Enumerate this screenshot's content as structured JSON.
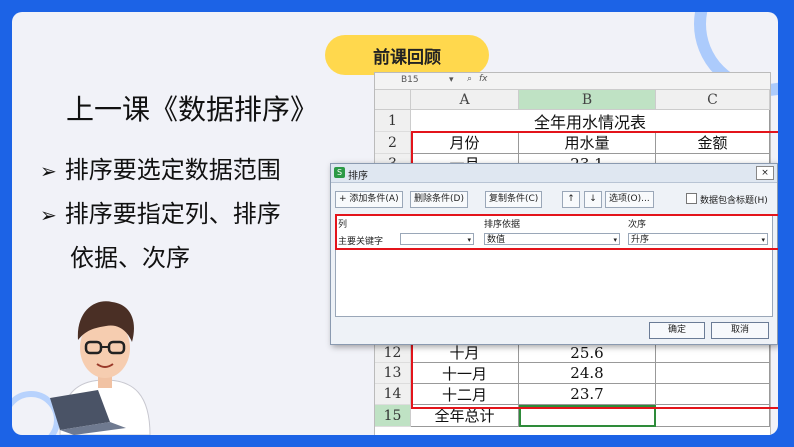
{
  "slide": {
    "badge": "前课回顾",
    "title": "上一课《数据排序》",
    "bullets": [
      {
        "arrow": "➢",
        "text": "排序要选定数据范围"
      },
      {
        "arrow": "➢",
        "text": "排序要指定列、排序"
      }
    ],
    "continuation": "依据、次序"
  },
  "sheet": {
    "name_box": "B15",
    "fx_label": "fx",
    "col_headers": [
      "A",
      "B",
      "C"
    ],
    "title_row": {
      "num": "1",
      "text": "全年用水情况表"
    },
    "header_row": {
      "num": "2",
      "cells": [
        "月份",
        "用水量",
        "金额"
      ]
    },
    "row3": {
      "num": "3",
      "cells": [
        "一月",
        "23.1",
        ""
      ]
    },
    "bottom_rows": [
      {
        "num": "12",
        "cells": [
          "十月",
          "25.6",
          ""
        ]
      },
      {
        "num": "13",
        "cells": [
          "十一月",
          "24.8",
          ""
        ]
      },
      {
        "num": "14",
        "cells": [
          "十二月",
          "23.7",
          ""
        ]
      },
      {
        "num": "15",
        "cells": [
          "全年总计",
          "",
          ""
        ]
      }
    ]
  },
  "dialog": {
    "title": "排序",
    "close": "×",
    "toolbar": {
      "add": "+ 添加条件(A)",
      "delete": "删除条件(D)",
      "copy": "复制条件(C)",
      "up": "↑",
      "down": "↓",
      "options": "选项(O)...",
      "has_header": "数据包含标题(H)"
    },
    "columns": {
      "col": "列",
      "basis": "排序依据",
      "order": "次序"
    },
    "row": {
      "key_label": "主要关键字",
      "key_value": "",
      "basis_value": "数值",
      "order_value": "升序"
    },
    "ok": "确定",
    "cancel": "取消"
  }
}
